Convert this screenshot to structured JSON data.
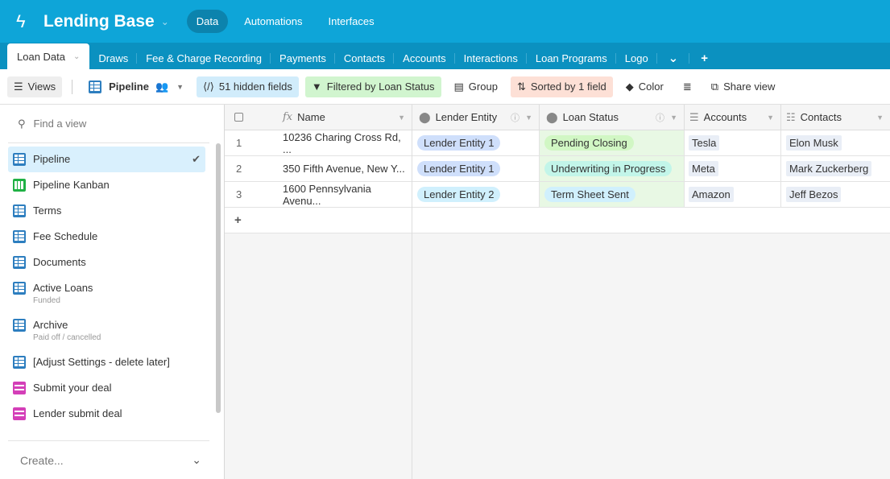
{
  "app": {
    "title": "Lending Base",
    "nav": [
      "Data",
      "Automations",
      "Interfaces"
    ],
    "active_nav": "Data"
  },
  "tabs": [
    "Loan Data",
    "Draws",
    "Fee & Charge Recording",
    "Payments",
    "Contacts",
    "Accounts",
    "Interactions",
    "Loan Programs",
    "Logo"
  ],
  "toolbar": {
    "views": "Views",
    "current_view": "Pipeline",
    "hidden": "51 hidden fields",
    "filtered": "Filtered by Loan Status",
    "group": "Group",
    "sorted": "Sorted by 1 field",
    "color": "Color",
    "share": "Share view"
  },
  "sidebar": {
    "search_placeholder": "Find a view",
    "views": [
      {
        "label": "Pipeline",
        "icon": "grid",
        "selected": true
      },
      {
        "label": "Pipeline Kanban",
        "icon": "kanban"
      },
      {
        "label": "Terms",
        "icon": "grid"
      },
      {
        "label": "Fee Schedule",
        "icon": "grid"
      },
      {
        "label": "Documents",
        "icon": "grid"
      },
      {
        "label": "Active Loans",
        "icon": "grid",
        "sub": "Funded"
      },
      {
        "label": "Archive",
        "icon": "grid",
        "sub": "Paid off / cancelled"
      },
      {
        "label": "[Adjust Settings - delete later]",
        "icon": "grid"
      },
      {
        "label": "Submit your deal",
        "icon": "form"
      },
      {
        "label": "Lender submit deal",
        "icon": "form"
      }
    ],
    "create": "Create..."
  },
  "grid": {
    "columns": [
      "Name",
      "Lender Entity",
      "Loan Status",
      "Accounts",
      "Contacts"
    ],
    "rows": [
      {
        "num": "1",
        "name": "10236 Charing Cross Rd, ...",
        "lender": "Lender Entity 1",
        "status": "Pending Closing",
        "account": "Tesla",
        "contact": "Elon Musk"
      },
      {
        "num": "2",
        "name": "350 Fifth Avenue, New Y...",
        "lender": "Lender Entity 1",
        "status": "Underwriting in Progress",
        "account": "Meta",
        "contact": "Mark Zuckerberg"
      },
      {
        "num": "3",
        "name": "1600 Pennsylvania Avenu...",
        "lender": "Lender Entity 2",
        "status": "Term Sheet Sent",
        "account": "Amazon",
        "contact": "Jeff Bezos"
      }
    ],
    "add_row": "+"
  },
  "colors": {
    "lender1": "#cfdffb",
    "lender2": "#d0f0fd",
    "pending": "#d1f7c4",
    "underwriting": "#c2f5e9",
    "termsheet": "#d0f0fd",
    "status_col_bg": "#e8f8e4"
  }
}
